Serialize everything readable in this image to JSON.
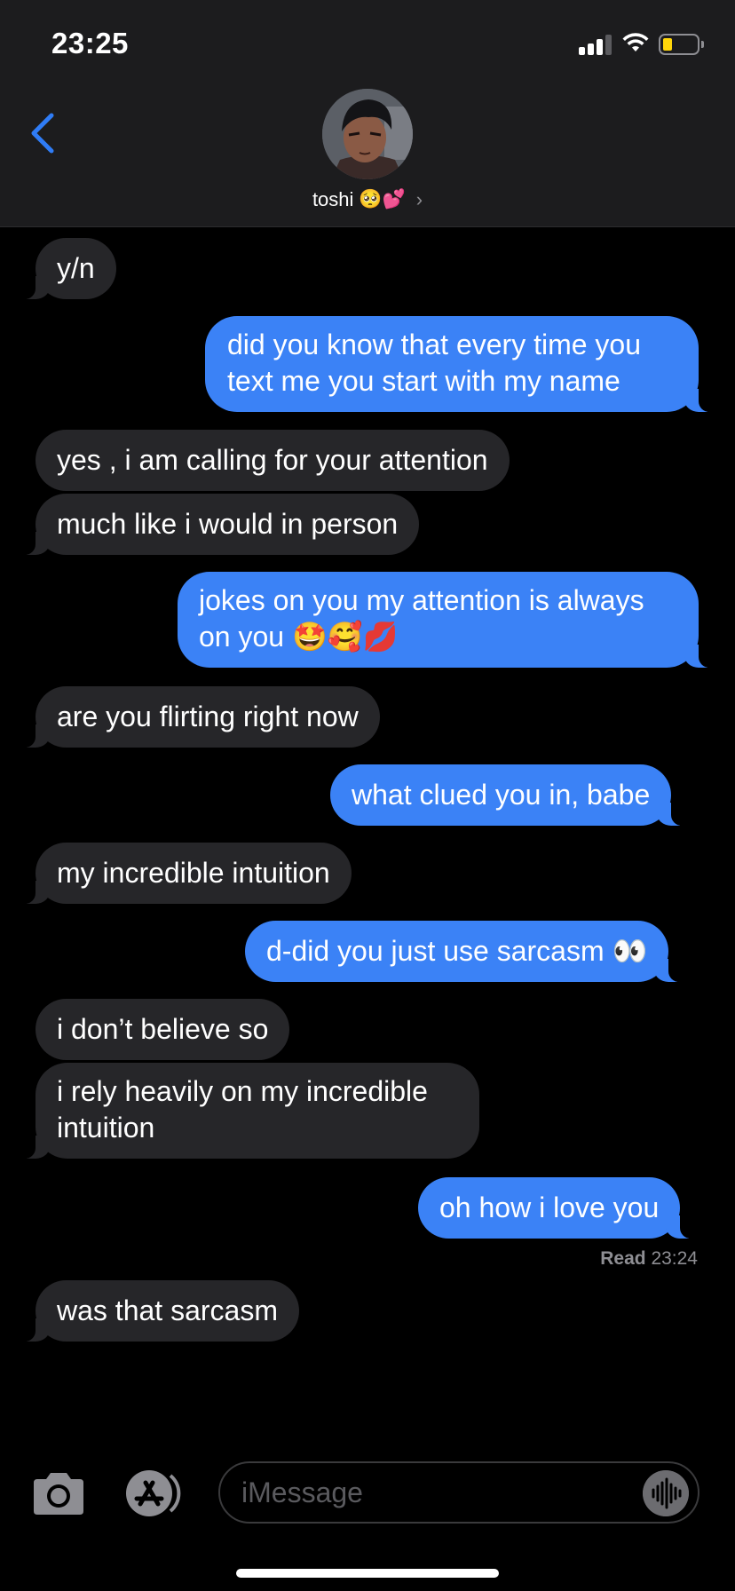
{
  "status_bar": {
    "time": "23:25",
    "signal_icon": "cellular-signal-icon",
    "wifi_icon": "wifi-icon",
    "battery_icon": "battery-low-icon"
  },
  "header": {
    "back_icon": "chevron-left-icon",
    "contact_name": "toshi",
    "contact_emojis": "🥺💕",
    "chevron": "›"
  },
  "colors": {
    "incoming_bubble": "#262629",
    "outgoing_bubble": "#3b82f6",
    "accent": "#2f7cf6",
    "header_bg": "#1c1c1e"
  },
  "messages": [
    {
      "dir": "in",
      "text": "y/n"
    },
    {
      "dir": "out",
      "text": "did you know that every time you text me you start with my name"
    },
    {
      "dir": "in",
      "text": "yes , i am calling for your attention"
    },
    {
      "dir": "in",
      "text": "much like i would in person"
    },
    {
      "dir": "out",
      "text": "jokes on you my attention is always on you 🤩🥰💋"
    },
    {
      "dir": "in",
      "text": "are you flirting right now"
    },
    {
      "dir": "out",
      "text": "what clued you in, babe"
    },
    {
      "dir": "in",
      "text": "my incredible intuition"
    },
    {
      "dir": "out",
      "text": "d-did you just use sarcasm 👀"
    },
    {
      "dir": "in",
      "text": "i don’t believe so"
    },
    {
      "dir": "in",
      "text": "i rely heavily on my incredible intuition"
    },
    {
      "dir": "out",
      "text": "oh how i love you"
    },
    {
      "dir": "in",
      "text": "was that sarcasm"
    }
  ],
  "read_receipt": {
    "label": "Read",
    "time": "23:24"
  },
  "compose": {
    "placeholder": "iMessage",
    "camera_icon": "camera-icon",
    "apps_icon": "app-store-icon",
    "audio_icon": "audio-waveform-icon"
  }
}
